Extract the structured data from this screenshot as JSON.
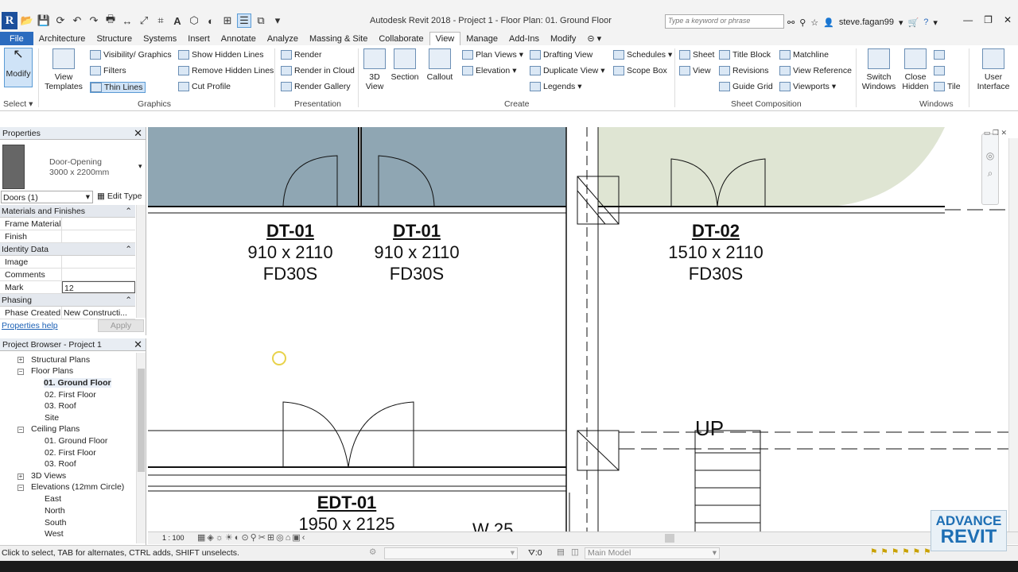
{
  "window": {
    "title": "Autodesk Revit 2018 -    Project 1 - Floor Plan: 01. Ground Floor",
    "search_placeholder": "Type a keyword or phrase",
    "user": "steve.fagan99"
  },
  "tabs": [
    "File",
    "Architecture",
    "Structure",
    "Systems",
    "Insert",
    "Annotate",
    "Analyze",
    "Massing & Site",
    "Collaborate",
    "View",
    "Manage",
    "Add-Ins",
    "Modify"
  ],
  "active_tab": "View",
  "ribbon": {
    "modify": "Modify",
    "select": "Select",
    "view_templates_1": "View",
    "view_templates_2": "Templates",
    "visibility_graphics": "Visibility/ Graphics",
    "filters": "Filters",
    "thin_lines": "Thin Lines",
    "show_hidden_lines": "Show Hidden Lines",
    "remove_hidden_lines": "Remove Hidden Lines",
    "cut_profile": "Cut Profile",
    "graphics_label": "Graphics",
    "render": "Render",
    "render_in_cloud": "Render in Cloud",
    "render_gallery": "Render Gallery",
    "presentation_label": "Presentation",
    "3d_view_1": "3D",
    "3d_view_2": "View",
    "section": "Section",
    "callout": "Callout",
    "plan_views": "Plan Views",
    "elevation": "Elevation",
    "drafting_view": "Drafting View",
    "duplicate_view": "Duplicate View",
    "legends": "Legends",
    "schedules": "Schedules",
    "scope_box": "Scope Box",
    "create_label": "Create",
    "sheet": "Sheet",
    "view": "View",
    "title_block": "Title Block",
    "revisions": "Revisions",
    "guide_grid": "Guide Grid",
    "matchline": "Matchline",
    "view_reference": "View Reference",
    "viewports": "Viewports",
    "sheet_composition_label": "Sheet Composition",
    "switch_windows_1": "Switch",
    "switch_windows_2": "Windows",
    "close_hidden_1": "Close",
    "close_hidden_2": "Hidden",
    "tile": "Tile",
    "windows_label": "Windows",
    "user_interface_1": "User",
    "user_interface_2": "Interface"
  },
  "properties": {
    "header": "Properties",
    "type_name": "Door-Opening",
    "type_size": "3000 x 2200mm",
    "selector": "Doors (1)",
    "edit_type": "Edit Type",
    "groups": {
      "materials": "Materials and Finishes",
      "identity": "Identity Data",
      "phasing": "Phasing"
    },
    "rows": {
      "frame_material": "Frame Material",
      "finish": "Finish",
      "image": "Image",
      "comments": "Comments",
      "mark": "Mark",
      "mark_value": "12",
      "phase_created": "Phase Created",
      "phase_created_value": "New Constructi..."
    },
    "help": "Properties help",
    "apply": "Apply"
  },
  "browser": {
    "header": "Project Browser - Project 1",
    "nodes": {
      "structural_plans": "Structural Plans",
      "floor_plans": "Floor Plans",
      "ground": "01. Ground Floor",
      "first": "02. First Floor",
      "roof": "03. Roof",
      "site": "Site",
      "ceiling_plans": "Ceiling Plans",
      "c_ground": "01. Ground Floor",
      "c_first": "02. First Floor",
      "c_roof": "03. Roof",
      "views3d": "3D Views",
      "elevations": "Elevations (12mm Circle)",
      "east": "East",
      "north": "North",
      "south": "South",
      "west": "West"
    }
  },
  "drawing": {
    "tags": [
      {
        "code": "DT-01",
        "size": "910 x 2110",
        "rating": "FD30S"
      },
      {
        "code": "DT-01",
        "size": "910 x 2110",
        "rating": "FD30S"
      },
      {
        "code": "DT-02",
        "size": "1510 x 2110",
        "rating": "FD30S"
      },
      {
        "code": "EDT-01",
        "size": "1950 x 2125",
        "rating": ""
      }
    ],
    "stair_label": "UP",
    "wall_label": "W 25"
  },
  "viewbar": {
    "scale": "1 : 100"
  },
  "status": {
    "hint": "Click to select, TAB for alternates, CTRL adds, SHIFT unselects.",
    "zero": ":0",
    "model": "Main Model"
  },
  "watermark": {
    "line1": "ADVANCE",
    "line2": "REVIT"
  },
  "colors": {
    "room_blue": "#8fa6b3",
    "room_green": "#dfe5d3",
    "file_tab": "#2b6cbf"
  }
}
